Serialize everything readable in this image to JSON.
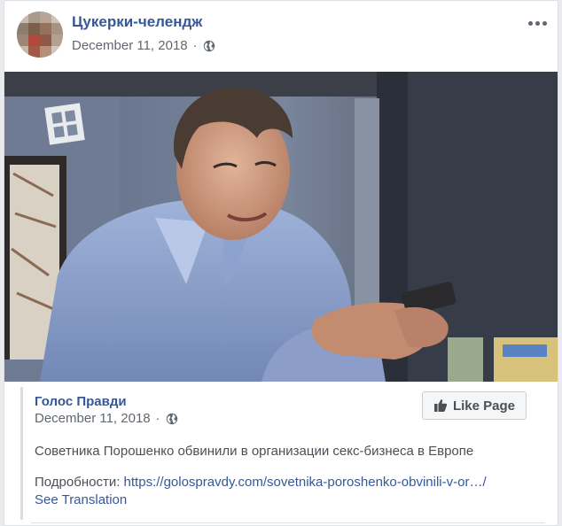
{
  "post": {
    "page_name": "Цукерки-челендж",
    "date": "December 11, 2018",
    "separator": "·",
    "privacy_icon": "globe-icon",
    "more_icon": "more-options-icon"
  },
  "photo": {
    "description_icon": "post-photo"
  },
  "shared_post": {
    "page_name": "Голос Правди",
    "date": "December 11, 2018",
    "separator": "·",
    "like_page_label": "Like Page",
    "text": "Советника Порошенко обвинили в организации секс-бизнеса в Европе",
    "details_label": "Подробности: ",
    "details_link": "https://golospravdy.com/sovetnika-poroshenko-obvinili-v-or…/",
    "see_translation": "See Translation"
  },
  "colors": {
    "link_blue": "#365899",
    "meta_gray": "#616770",
    "background": "#e9ebee",
    "card": "#ffffff"
  }
}
